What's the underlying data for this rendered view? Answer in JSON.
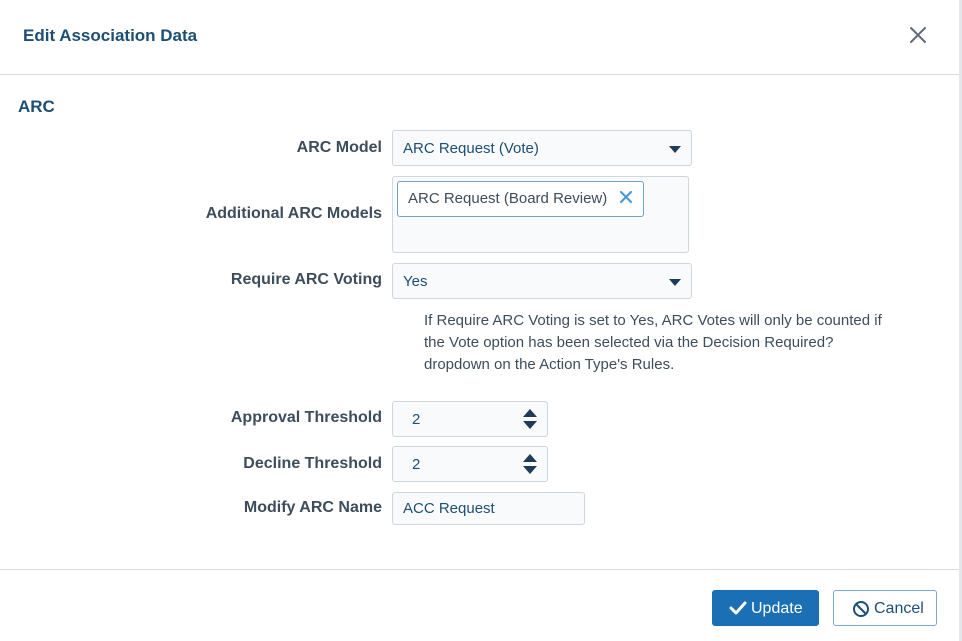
{
  "dialog": {
    "title": "Edit Association Data",
    "close_icon": "close-icon"
  },
  "section": {
    "title": "ARC"
  },
  "fields": {
    "arc_model": {
      "label": "ARC Model",
      "value": "ARC Request (Vote)"
    },
    "additional_models": {
      "label": "Additional ARC Models",
      "chips": [
        "ARC Request (Board Review)"
      ]
    },
    "require_voting": {
      "label": "Require ARC Voting",
      "value": "Yes"
    },
    "help_text": "If Require ARC Voting is set to Yes, ARC Votes will only be counted if the Vote option has been selected via the Decision Required? dropdown on the Action Type's Rules.",
    "approval_threshold": {
      "label": "Approval Threshold",
      "value": "2"
    },
    "decline_threshold": {
      "label": "Decline Threshold",
      "value": "2"
    },
    "modify_name": {
      "label": "Modify ARC Name",
      "value": "ACC Request"
    }
  },
  "footer": {
    "update_label": "Update",
    "cancel_label": "Cancel"
  },
  "colors": {
    "primary": "#1a6fb5",
    "title": "#1d4f74",
    "border": "#cfd6dd",
    "chip_x": "#4a9bd4"
  }
}
